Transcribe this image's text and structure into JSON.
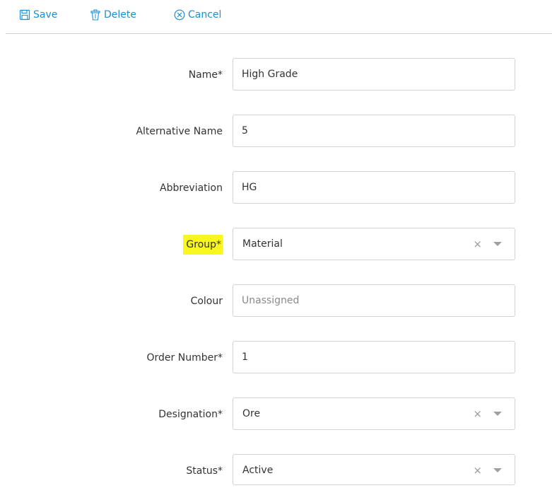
{
  "toolbar": {
    "save_label": "Save",
    "delete_label": "Delete",
    "cancel_label": "Cancel",
    "accent_color": "#1a8fd1"
  },
  "form": {
    "name": {
      "label": "Name*",
      "value": "High Grade"
    },
    "alternative_name": {
      "label": "Alternative Name",
      "value": "5"
    },
    "abbreviation": {
      "label": "Abbreviation",
      "value": "HG"
    },
    "group": {
      "label": "Group*",
      "value": "Material",
      "clear": "×",
      "highlight_color": "#f7f71f"
    },
    "colour": {
      "label": "Colour",
      "placeholder": "Unassigned"
    },
    "order_number": {
      "label": "Order Number*",
      "value": "1"
    },
    "designation": {
      "label": "Designation*",
      "value": "Ore",
      "clear": "×"
    },
    "status": {
      "label": "Status*",
      "value": "Active",
      "clear": "×"
    }
  },
  "icons": {
    "save": "floppy-disk-icon",
    "delete": "trash-icon",
    "cancel": "circle-x-icon",
    "dropdown": "chevron-down-icon"
  }
}
